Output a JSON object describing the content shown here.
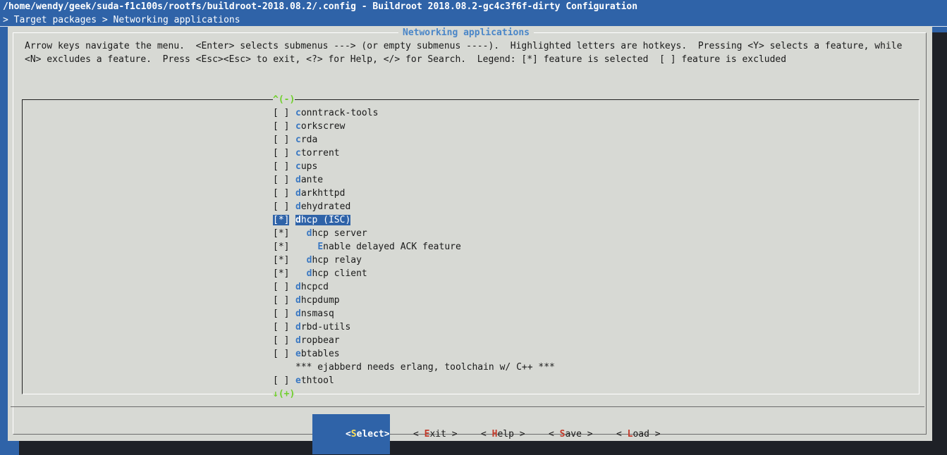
{
  "window": {
    "title": "/home/wendy/geek/suda-f1c100s/rootfs/buildroot-2018.08.2/.config - Buildroot 2018.08.2-gc4c3f6f-dirty Configuration",
    "breadcrumb": "> Target packages > Networking applications"
  },
  "dialog": {
    "title": "Networking applications",
    "help_line_1": "Arrow keys navigate the menu.  <Enter> selects submenus ---> (or empty submenus ----).  Highlighted letters are hotkeys.  Pressing <Y> selects a feature, while",
    "help_line_2": "<N> excludes a feature.  Press <Esc><Esc> to exit, <?> for Help, </> for Search.  Legend: [*] feature is selected  [ ] feature is excluded",
    "scroll_up": "^(-)",
    "scroll_down": "↓(+)"
  },
  "menu": {
    "items": [
      {
        "check": "[ ]",
        "indent": "",
        "hot": "c",
        "rest": "onntrack-tools"
      },
      {
        "check": "[ ]",
        "indent": "",
        "hot": "c",
        "rest": "orkscrew"
      },
      {
        "check": "[ ]",
        "indent": "",
        "hot": "c",
        "rest": "rda"
      },
      {
        "check": "[ ]",
        "indent": "",
        "hot": "c",
        "rest": "torrent"
      },
      {
        "check": "[ ]",
        "indent": "",
        "hot": "c",
        "rest": "ups"
      },
      {
        "check": "[ ]",
        "indent": "",
        "hot": "d",
        "rest": "ante"
      },
      {
        "check": "[ ]",
        "indent": "",
        "hot": "d",
        "rest": "arkhttpd"
      },
      {
        "check": "[ ]",
        "indent": "",
        "hot": "d",
        "rest": "ehydrated"
      },
      {
        "check": "[*]",
        "indent": "",
        "hot": "d",
        "rest": "hcp (ISC)"
      },
      {
        "check": "[*]",
        "indent": "  ",
        "hot": "d",
        "rest": "hcp server"
      },
      {
        "check": "[*]",
        "indent": "    ",
        "hot": "E",
        "rest": "nable delayed ACK feature"
      },
      {
        "check": "[*]",
        "indent": "  ",
        "hot": "d",
        "rest": "hcp relay"
      },
      {
        "check": "[*]",
        "indent": "  ",
        "hot": "d",
        "rest": "hcp client"
      },
      {
        "check": "[ ]",
        "indent": "",
        "hot": "d",
        "rest": "hcpcd"
      },
      {
        "check": "[ ]",
        "indent": "",
        "hot": "d",
        "rest": "hcpdump"
      },
      {
        "check": "[ ]",
        "indent": "",
        "hot": "d",
        "rest": "nsmasq"
      },
      {
        "check": "[ ]",
        "indent": "",
        "hot": "d",
        "rest": "rbd-utils"
      },
      {
        "check": "[ ]",
        "indent": "",
        "hot": "d",
        "rest": "ropbear"
      },
      {
        "check": "[ ]",
        "indent": "",
        "hot": "e",
        "rest": "btables"
      },
      {
        "check": "",
        "indent": "",
        "hot": "",
        "rest": "*** ejabberd needs erlang, toolchain w/ C++ ***"
      },
      {
        "check": "[ ]",
        "indent": "",
        "hot": "e",
        "rest": "thtool"
      }
    ],
    "selected_index": 8
  },
  "buttons": [
    {
      "open": "<",
      "hot": "S",
      "rest": "elect",
      "close": ">"
    },
    {
      "open": "< ",
      "hot": "E",
      "rest": "xit",
      "close": " >"
    },
    {
      "open": "< ",
      "hot": "H",
      "rest": "elp",
      "close": " >"
    },
    {
      "open": "< ",
      "hot": "S",
      "rest": "ave",
      "close": " >"
    },
    {
      "open": "< ",
      "hot": "L",
      "rest": "oad",
      "close": " >"
    }
  ],
  "colors": {
    "screen_bg": "#2f63a8",
    "dialog_bg": "#d7d9d4",
    "hotkey": "#3a78c2",
    "button_hotkey": "#c33b2b",
    "scroll_marker": "#6fd02b"
  }
}
